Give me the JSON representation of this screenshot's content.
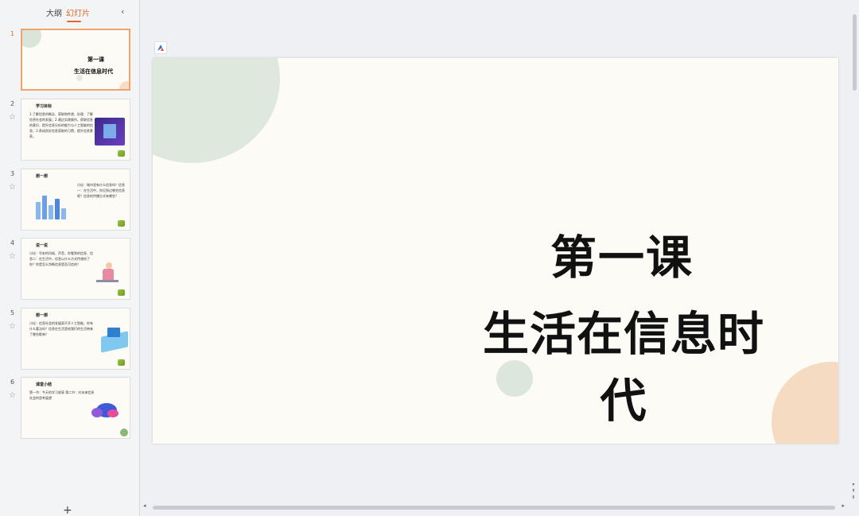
{
  "panel": {
    "tab_outline": "大纲",
    "tab_slides": "幻灯片",
    "collapse_icon": "‹",
    "add_slide_icon": "+"
  },
  "slides": [
    {
      "num": "1",
      "line1": "第一课",
      "line2": "生活在信息时代"
    },
    {
      "num": "2",
      "title": "学习目标",
      "body": "1.了解信息的概念、获取和传递、处理、了解信息社会的发展；2.通过实践操作，获取信息的意识、提升信息分析的能力与人工智能的信息；3.养成良好信息获取的习惯，提升信息素养。"
    },
    {
      "num": "3",
      "title": "想一想",
      "body": "讨论：城市里有什么信息吗？信息一：在生活中，你见到过哪些信息呢？信息的传播方式有哪些？"
    },
    {
      "num": "4",
      "title": "说一说",
      "body": "讨论：早安的问候、声音、你看到的信息、信息二：在生活中，信息以什么方式传递给了你？你是怎么判断信息是否可信的？"
    },
    {
      "num": "5",
      "title": "想一想",
      "body": "讨论：信息社会的发展离不开人工智能，你有什么看法吗？信息在生活里给我们的生活带来了哪些影响？"
    },
    {
      "num": "6",
      "title": "课堂小结",
      "body": "第一节：今天的学习收获 第二节：对未来信息社会的思考展望"
    }
  ],
  "main_slide": {
    "line1": "第一课",
    "line2": "生活在信息时代"
  },
  "colors": {
    "accent": "#e0672a",
    "slide_bg": "#fcfbf6",
    "green_circle": "#dfe8dc",
    "orange_circle": "#f6dbc3"
  },
  "icons": {
    "star": "☆",
    "app": "app-logo-icon",
    "scroll_left": "◂",
    "scroll_right": "▸",
    "scroll_down": "▾"
  }
}
